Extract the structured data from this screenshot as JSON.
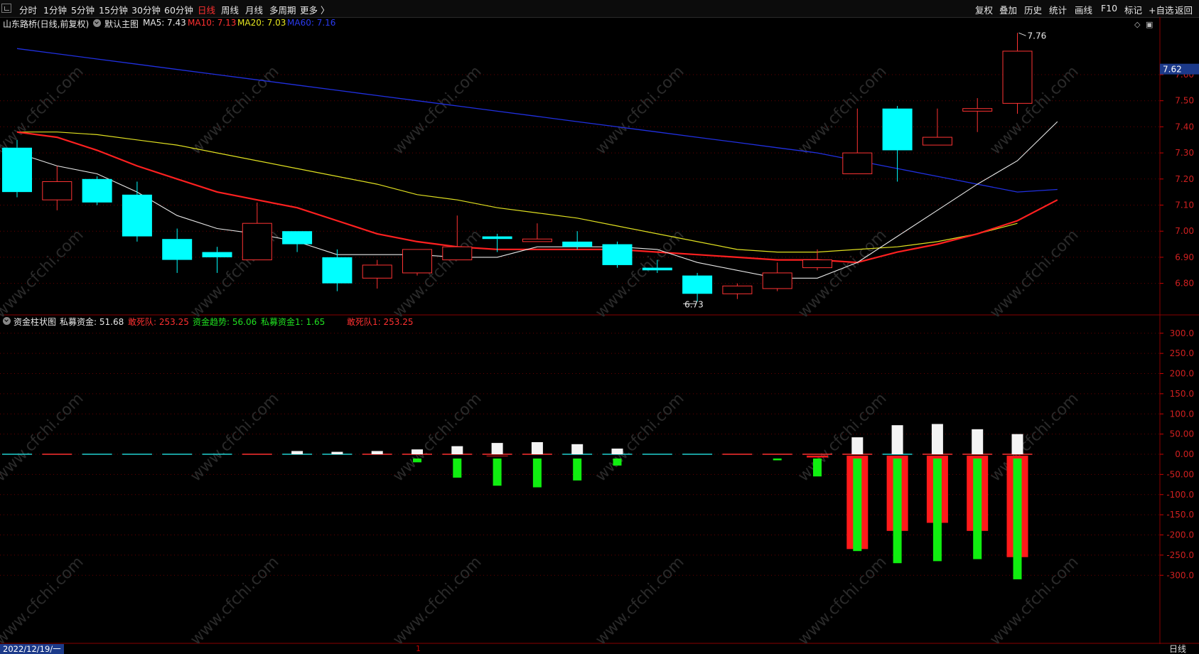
{
  "toolbar": {
    "periods": [
      "分时",
      "1分钟",
      "5分钟",
      "15分钟",
      "30分钟",
      "60分钟",
      "日线",
      "周线",
      "月线",
      "多周期",
      "更多 〉"
    ],
    "active_period": "日线",
    "tools": [
      "复权",
      "叠加",
      "历史",
      "统计",
      "画线",
      "F10",
      "标记",
      "+自选",
      "返回"
    ]
  },
  "main_chart": {
    "title": "山东路桥(日线,前复权)",
    "indicator": "默认主图",
    "ma5": "MA5: 7.43",
    "ma10": "MA10: 7.13",
    "ma20": "MA20: 7.03",
    "ma60": "MA60: 7.16",
    "current_price_tag": "7.62",
    "high_label": "7.76",
    "low_label": "6.73",
    "y_ticks": [
      "7.60",
      "7.50",
      "7.40",
      "7.30",
      "7.20",
      "7.10",
      "7.00",
      "6.90",
      "6.80"
    ]
  },
  "sub_chart": {
    "indicator": "资金柱状图",
    "private_fund": "私募资金: 51.68",
    "dare_die": "敢死队: 253.25",
    "fund_trend": "资金趋势: 56.06",
    "private_fund1": "私募资金1: 1.65",
    "dare_die1": "敢死队1: 253.25",
    "y_ticks": [
      "300.0",
      "250.0",
      "200.0",
      "150.0",
      "100.0",
      "50.00",
      "0.00",
      "-50.00",
      "-100.0",
      "-150.0",
      "-200.0",
      "-250.0",
      "-300.0"
    ]
  },
  "footer": {
    "date": "2022/12/19/一",
    "marker": "1",
    "tab": "日线"
  },
  "colors": {
    "up": "#ff3333",
    "down": "#00ffff",
    "ma5": "#e8e8e8",
    "ma10": "#ff2020",
    "ma20": "#e0e020",
    "ma60": "#2030e0",
    "grid": "#6a0000"
  },
  "chart_data": {
    "type": "candlestick",
    "price_range": [
      6.66,
      7.81
    ],
    "candles": [
      {
        "o": 7.32,
        "h": 7.35,
        "l": 7.13,
        "c": 7.15
      },
      {
        "o": 7.12,
        "h": 7.25,
        "l": 7.08,
        "c": 7.19
      },
      {
        "o": 7.2,
        "h": 7.21,
        "l": 7.1,
        "c": 7.11
      },
      {
        "o": 7.14,
        "h": 7.19,
        "l": 6.96,
        "c": 6.98
      },
      {
        "o": 6.97,
        "h": 7.01,
        "l": 6.84,
        "c": 6.89
      },
      {
        "o": 6.92,
        "h": 6.94,
        "l": 6.84,
        "c": 6.9
      },
      {
        "o": 6.89,
        "h": 7.11,
        "l": 6.89,
        "c": 7.03
      },
      {
        "o": 7.0,
        "h": 7.0,
        "l": 6.92,
        "c": 6.95
      },
      {
        "o": 6.9,
        "h": 6.93,
        "l": 6.77,
        "c": 6.8
      },
      {
        "o": 6.82,
        "h": 6.89,
        "l": 6.78,
        "c": 6.87
      },
      {
        "o": 6.84,
        "h": 6.93,
        "l": 6.83,
        "c": 6.93
      },
      {
        "o": 6.89,
        "h": 7.06,
        "l": 6.89,
        "c": 6.94
      },
      {
        "o": 6.98,
        "h": 6.99,
        "l": 6.92,
        "c": 6.97
      },
      {
        "o": 6.96,
        "h": 7.03,
        "l": 6.96,
        "c": 6.97
      },
      {
        "o": 6.96,
        "h": 7.0,
        "l": 6.93,
        "c": 6.94
      },
      {
        "o": 6.95,
        "h": 6.96,
        "l": 6.86,
        "c": 6.87
      },
      {
        "o": 6.86,
        "h": 6.89,
        "l": 6.84,
        "c": 6.85
      },
      {
        "o": 6.83,
        "h": 6.84,
        "l": 6.73,
        "c": 6.76
      },
      {
        "o": 6.76,
        "h": 6.8,
        "l": 6.74,
        "c": 6.79
      },
      {
        "o": 6.78,
        "h": 6.88,
        "l": 6.77,
        "c": 6.84
      },
      {
        "o": 6.86,
        "h": 6.93,
        "l": 6.85,
        "c": 6.89
      },
      {
        "o": 7.22,
        "h": 7.47,
        "l": 7.22,
        "c": 7.3
      },
      {
        "o": 7.47,
        "h": 7.48,
        "l": 7.19,
        "c": 7.31
      },
      {
        "o": 7.33,
        "h": 7.47,
        "l": 7.33,
        "c": 7.36
      },
      {
        "o": 7.46,
        "h": 7.51,
        "l": 7.38,
        "c": 7.47
      },
      {
        "o": 7.49,
        "h": 7.76,
        "l": 7.45,
        "c": 7.69
      }
    ],
    "ma5": [
      7.3,
      7.25,
      7.22,
      7.15,
      7.06,
      7.01,
      6.99,
      6.96,
      6.91,
      6.91,
      6.91,
      6.9,
      6.9,
      6.94,
      6.94,
      6.94,
      6.93,
      6.88,
      6.85,
      6.82,
      6.82,
      6.88,
      6.98,
      7.08,
      7.18,
      7.27,
      7.42
    ],
    "ma10": [
      7.38,
      7.36,
      7.31,
      7.25,
      7.2,
      7.15,
      7.12,
      7.09,
      7.04,
      6.99,
      6.96,
      6.94,
      6.93,
      6.93,
      6.93,
      6.93,
      6.92,
      6.91,
      6.9,
      6.89,
      6.89,
      6.88,
      6.92,
      6.95,
      6.99,
      7.04,
      7.12
    ],
    "ma20": [
      7.38,
      7.38,
      7.37,
      7.35,
      7.33,
      7.3,
      7.27,
      7.24,
      7.21,
      7.18,
      7.14,
      7.12,
      7.09,
      7.07,
      7.05,
      7.02,
      6.99,
      6.96,
      6.93,
      6.92,
      6.92,
      6.93,
      6.94,
      6.96,
      6.99,
      7.03
    ],
    "ma60": [
      7.7,
      7.68,
      7.66,
      7.64,
      7.62,
      7.6,
      7.58,
      7.56,
      7.54,
      7.52,
      7.5,
      7.48,
      7.46,
      7.44,
      7.42,
      7.4,
      7.38,
      7.36,
      7.34,
      7.32,
      7.3,
      7.27,
      7.24,
      7.21,
      7.18,
      7.15,
      7.16
    ],
    "fund_range": [
      -340,
      340
    ],
    "fund_white": [
      0,
      0,
      0,
      0,
      0,
      0,
      0,
      8,
      6,
      8,
      12,
      20,
      28,
      30,
      25,
      14,
      0,
      0,
      0,
      0,
      0,
      42,
      72,
      75,
      62,
      50
    ],
    "fund_red": [
      0,
      0,
      0,
      0,
      0,
      0,
      0,
      0,
      0,
      0,
      0,
      0,
      -5,
      -3,
      0,
      0,
      0,
      0,
      0,
      0,
      -8,
      -235,
      -190,
      -170,
      -190,
      -255
    ],
    "fund_green": [
      0,
      0,
      0,
      0,
      0,
      0,
      0,
      0,
      0,
      0,
      -20,
      -58,
      -78,
      -82,
      -65,
      -28,
      -5,
      0,
      0,
      -15,
      -55,
      -240,
      -270,
      -265,
      -260,
      -310
    ],
    "fund_flat": [
      "c",
      "r",
      "c",
      "c",
      "c",
      "c",
      "r",
      "c",
      "c",
      "r",
      "r",
      "r",
      "r",
      "r",
      "c",
      "c",
      "c",
      "c",
      "r",
      "r",
      "r",
      "r",
      "c",
      "r",
      "r",
      "r"
    ]
  }
}
